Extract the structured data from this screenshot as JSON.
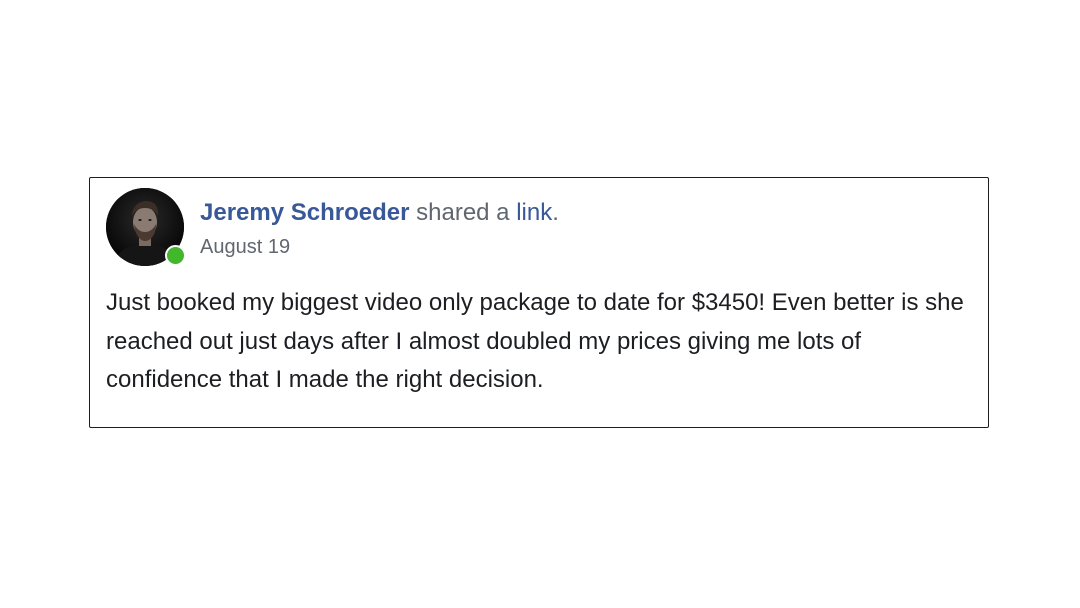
{
  "post": {
    "author": "Jeremy Schroeder",
    "action_text": "shared a",
    "link_word": "link",
    "period": ".",
    "date": "August 19",
    "body": "Just booked my biggest video only package to date for $3450! Even better is she reached out just days after I almost doubled my prices giving me lots of confidence that I made the right decision.",
    "online_status_color": "#42b72a",
    "name_color": "#385898"
  }
}
